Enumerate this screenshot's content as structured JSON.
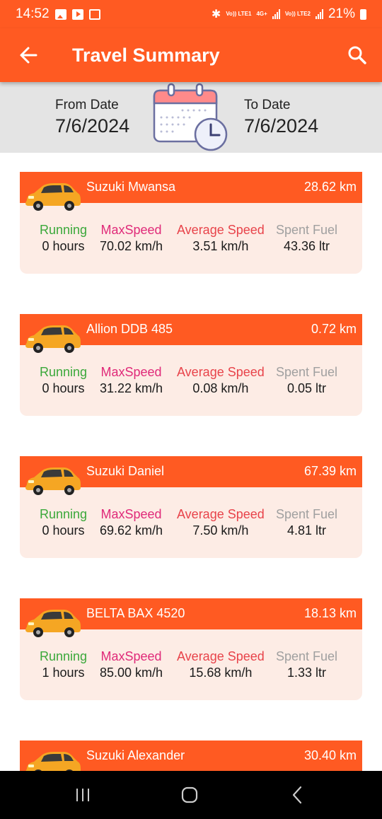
{
  "status_bar": {
    "time": "14:52",
    "battery": "21%",
    "net1": "Vo)) LTE1",
    "net2": "4G+",
    "net3": "Vo)) LTE2"
  },
  "app_bar": {
    "title": "Travel Summary"
  },
  "dates": {
    "from_label": "From Date",
    "from_value": "7/6/2024",
    "to_label": "To Date",
    "to_value": "7/6/2024"
  },
  "stat_labels": {
    "running": "Running",
    "max_speed": "MaxSpeed",
    "avg_speed": "Average Speed",
    "fuel": "Spent Fuel"
  },
  "vehicles": [
    {
      "name": "Suzuki Mwansa",
      "distance": "28.62 km",
      "running": "0 hours",
      "max_speed": "70.02 km/h",
      "avg_speed": "3.51 km/h",
      "fuel": "43.36 ltr"
    },
    {
      "name": "Allion DDB 485",
      "distance": "0.72 km",
      "running": "0 hours",
      "max_speed": "31.22 km/h",
      "avg_speed": "0.08 km/h",
      "fuel": "0.05 ltr"
    },
    {
      "name": "Suzuki Daniel",
      "distance": "67.39 km",
      "running": "0 hours",
      "max_speed": "69.62 km/h",
      "avg_speed": "7.50 km/h",
      "fuel": "4.81 ltr"
    },
    {
      "name": "BELTA BAX 4520",
      "distance": "18.13 km",
      "running": "1 hours",
      "max_speed": "85.00 km/h",
      "avg_speed": "15.68 km/h",
      "fuel": "1.33 ltr"
    },
    {
      "name": "Suzuki Alexander",
      "distance": "30.40 km"
    }
  ],
  "colors": {
    "accent": "#ff5a22",
    "card_bg": "#fdece5",
    "running": "#3aa83a",
    "max_speed": "#e02a79",
    "avg_speed": "#e8434a",
    "fuel": "#a0a0a0"
  },
  "icons": {
    "back": "arrow-left-icon",
    "search": "search-icon",
    "calendar": "calendar-clock-icon",
    "car": "car-icon"
  }
}
